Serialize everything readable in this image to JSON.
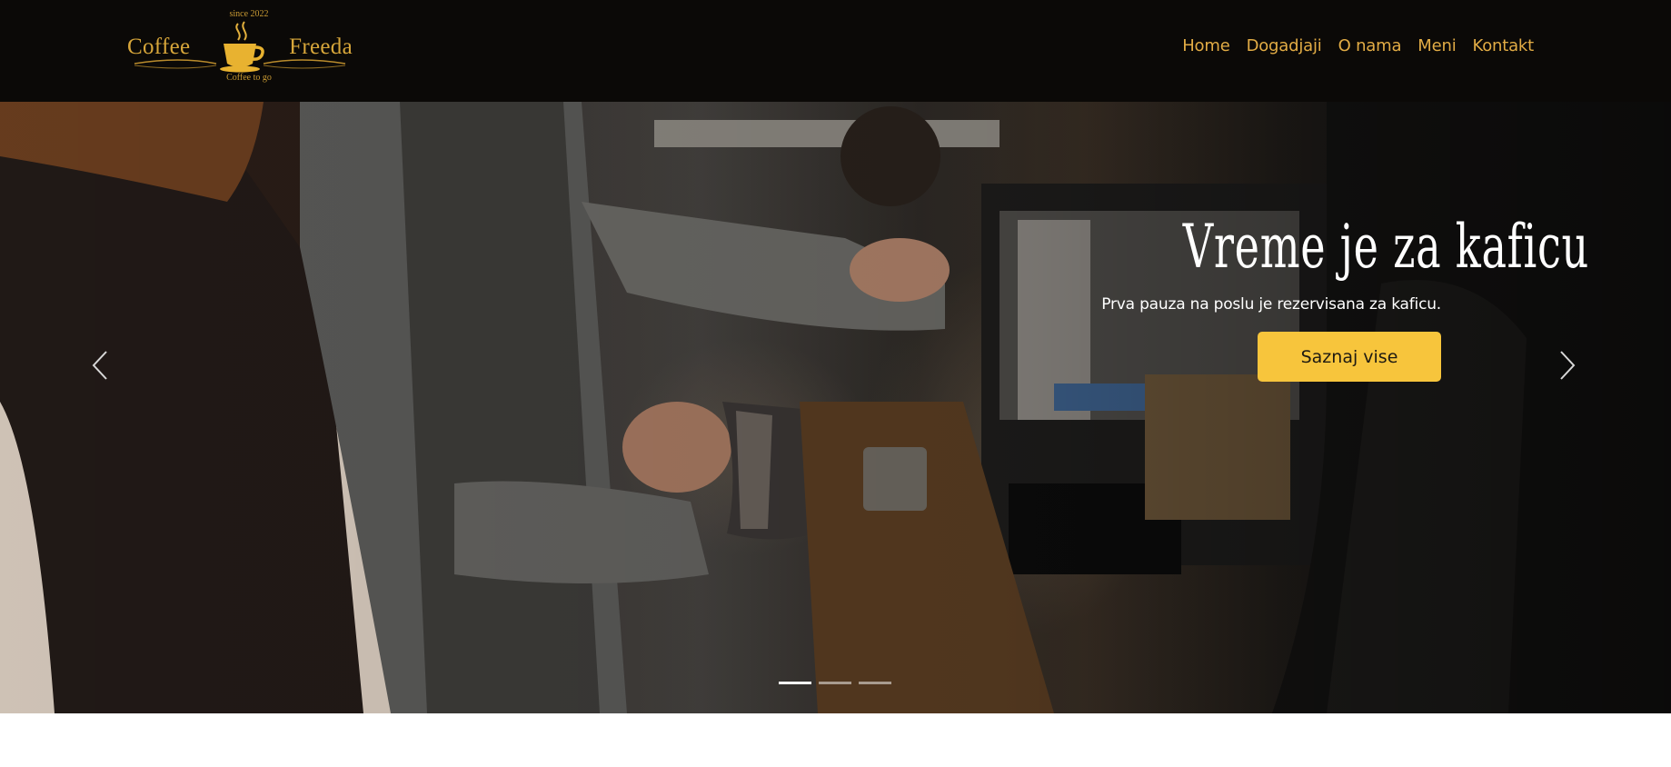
{
  "brand": {
    "left_word": "Coffee",
    "right_word": "Freeda",
    "since": "since 2022",
    "tagline": "Coffee to go",
    "logo_icon": "coffee-cup-icon",
    "color": "#d7a63a"
  },
  "nav": {
    "items": [
      {
        "label": "Home"
      },
      {
        "label": "Dogadjaji"
      },
      {
        "label": "O nama"
      },
      {
        "label": "Meni"
      },
      {
        "label": "Kontakt"
      }
    ],
    "color": "#e2ac45"
  },
  "hero": {
    "title": "Vreme je za kaficu",
    "text": "Prva pauza na poslu je rezervisana za kaficu.",
    "button_label": "Saznaj vise",
    "button_color": "#f7c53c",
    "prev_icon": "chevron-left-icon",
    "next_icon": "chevron-right-icon",
    "slides_total": 3,
    "active_slide": 1
  }
}
